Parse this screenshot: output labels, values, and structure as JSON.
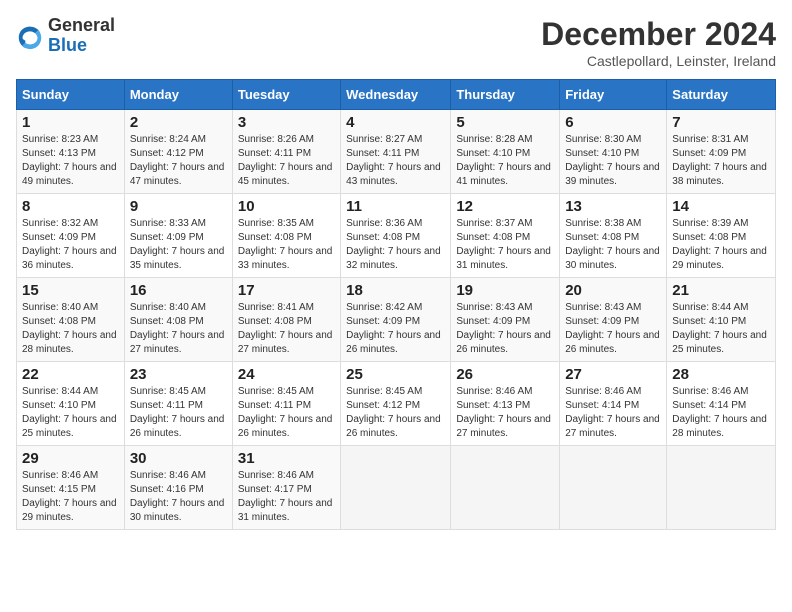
{
  "header": {
    "logo": {
      "line1": "General",
      "line2": "Blue"
    },
    "month": "December 2024",
    "location": "Castlepollard, Leinster, Ireland"
  },
  "weekdays": [
    "Sunday",
    "Monday",
    "Tuesday",
    "Wednesday",
    "Thursday",
    "Friday",
    "Saturday"
  ],
  "weeks": [
    [
      {
        "day": "1",
        "sunrise": "8:23 AM",
        "sunset": "4:13 PM",
        "daylight": "7 hours and 49 minutes."
      },
      {
        "day": "2",
        "sunrise": "8:24 AM",
        "sunset": "4:12 PM",
        "daylight": "7 hours and 47 minutes."
      },
      {
        "day": "3",
        "sunrise": "8:26 AM",
        "sunset": "4:11 PM",
        "daylight": "7 hours and 45 minutes."
      },
      {
        "day": "4",
        "sunrise": "8:27 AM",
        "sunset": "4:11 PM",
        "daylight": "7 hours and 43 minutes."
      },
      {
        "day": "5",
        "sunrise": "8:28 AM",
        "sunset": "4:10 PM",
        "daylight": "7 hours and 41 minutes."
      },
      {
        "day": "6",
        "sunrise": "8:30 AM",
        "sunset": "4:10 PM",
        "daylight": "7 hours and 39 minutes."
      },
      {
        "day": "7",
        "sunrise": "8:31 AM",
        "sunset": "4:09 PM",
        "daylight": "7 hours and 38 minutes."
      }
    ],
    [
      {
        "day": "8",
        "sunrise": "8:32 AM",
        "sunset": "4:09 PM",
        "daylight": "7 hours and 36 minutes."
      },
      {
        "day": "9",
        "sunrise": "8:33 AM",
        "sunset": "4:09 PM",
        "daylight": "7 hours and 35 minutes."
      },
      {
        "day": "10",
        "sunrise": "8:35 AM",
        "sunset": "4:08 PM",
        "daylight": "7 hours and 33 minutes."
      },
      {
        "day": "11",
        "sunrise": "8:36 AM",
        "sunset": "4:08 PM",
        "daylight": "7 hours and 32 minutes."
      },
      {
        "day": "12",
        "sunrise": "8:37 AM",
        "sunset": "4:08 PM",
        "daylight": "7 hours and 31 minutes."
      },
      {
        "day": "13",
        "sunrise": "8:38 AM",
        "sunset": "4:08 PM",
        "daylight": "7 hours and 30 minutes."
      },
      {
        "day": "14",
        "sunrise": "8:39 AM",
        "sunset": "4:08 PM",
        "daylight": "7 hours and 29 minutes."
      }
    ],
    [
      {
        "day": "15",
        "sunrise": "8:40 AM",
        "sunset": "4:08 PM",
        "daylight": "7 hours and 28 minutes."
      },
      {
        "day": "16",
        "sunrise": "8:40 AM",
        "sunset": "4:08 PM",
        "daylight": "7 hours and 27 minutes."
      },
      {
        "day": "17",
        "sunrise": "8:41 AM",
        "sunset": "4:08 PM",
        "daylight": "7 hours and 27 minutes."
      },
      {
        "day": "18",
        "sunrise": "8:42 AM",
        "sunset": "4:09 PM",
        "daylight": "7 hours and 26 minutes."
      },
      {
        "day": "19",
        "sunrise": "8:43 AM",
        "sunset": "4:09 PM",
        "daylight": "7 hours and 26 minutes."
      },
      {
        "day": "20",
        "sunrise": "8:43 AM",
        "sunset": "4:09 PM",
        "daylight": "7 hours and 26 minutes."
      },
      {
        "day": "21",
        "sunrise": "8:44 AM",
        "sunset": "4:10 PM",
        "daylight": "7 hours and 25 minutes."
      }
    ],
    [
      {
        "day": "22",
        "sunrise": "8:44 AM",
        "sunset": "4:10 PM",
        "daylight": "7 hours and 25 minutes."
      },
      {
        "day": "23",
        "sunrise": "8:45 AM",
        "sunset": "4:11 PM",
        "daylight": "7 hours and 26 minutes."
      },
      {
        "day": "24",
        "sunrise": "8:45 AM",
        "sunset": "4:11 PM",
        "daylight": "7 hours and 26 minutes."
      },
      {
        "day": "25",
        "sunrise": "8:45 AM",
        "sunset": "4:12 PM",
        "daylight": "7 hours and 26 minutes."
      },
      {
        "day": "26",
        "sunrise": "8:46 AM",
        "sunset": "4:13 PM",
        "daylight": "7 hours and 27 minutes."
      },
      {
        "day": "27",
        "sunrise": "8:46 AM",
        "sunset": "4:14 PM",
        "daylight": "7 hours and 27 minutes."
      },
      {
        "day": "28",
        "sunrise": "8:46 AM",
        "sunset": "4:14 PM",
        "daylight": "7 hours and 28 minutes."
      }
    ],
    [
      {
        "day": "29",
        "sunrise": "8:46 AM",
        "sunset": "4:15 PM",
        "daylight": "7 hours and 29 minutes."
      },
      {
        "day": "30",
        "sunrise": "8:46 AM",
        "sunset": "4:16 PM",
        "daylight": "7 hours and 30 minutes."
      },
      {
        "day": "31",
        "sunrise": "8:46 AM",
        "sunset": "4:17 PM",
        "daylight": "7 hours and 31 minutes."
      },
      null,
      null,
      null,
      null
    ]
  ]
}
